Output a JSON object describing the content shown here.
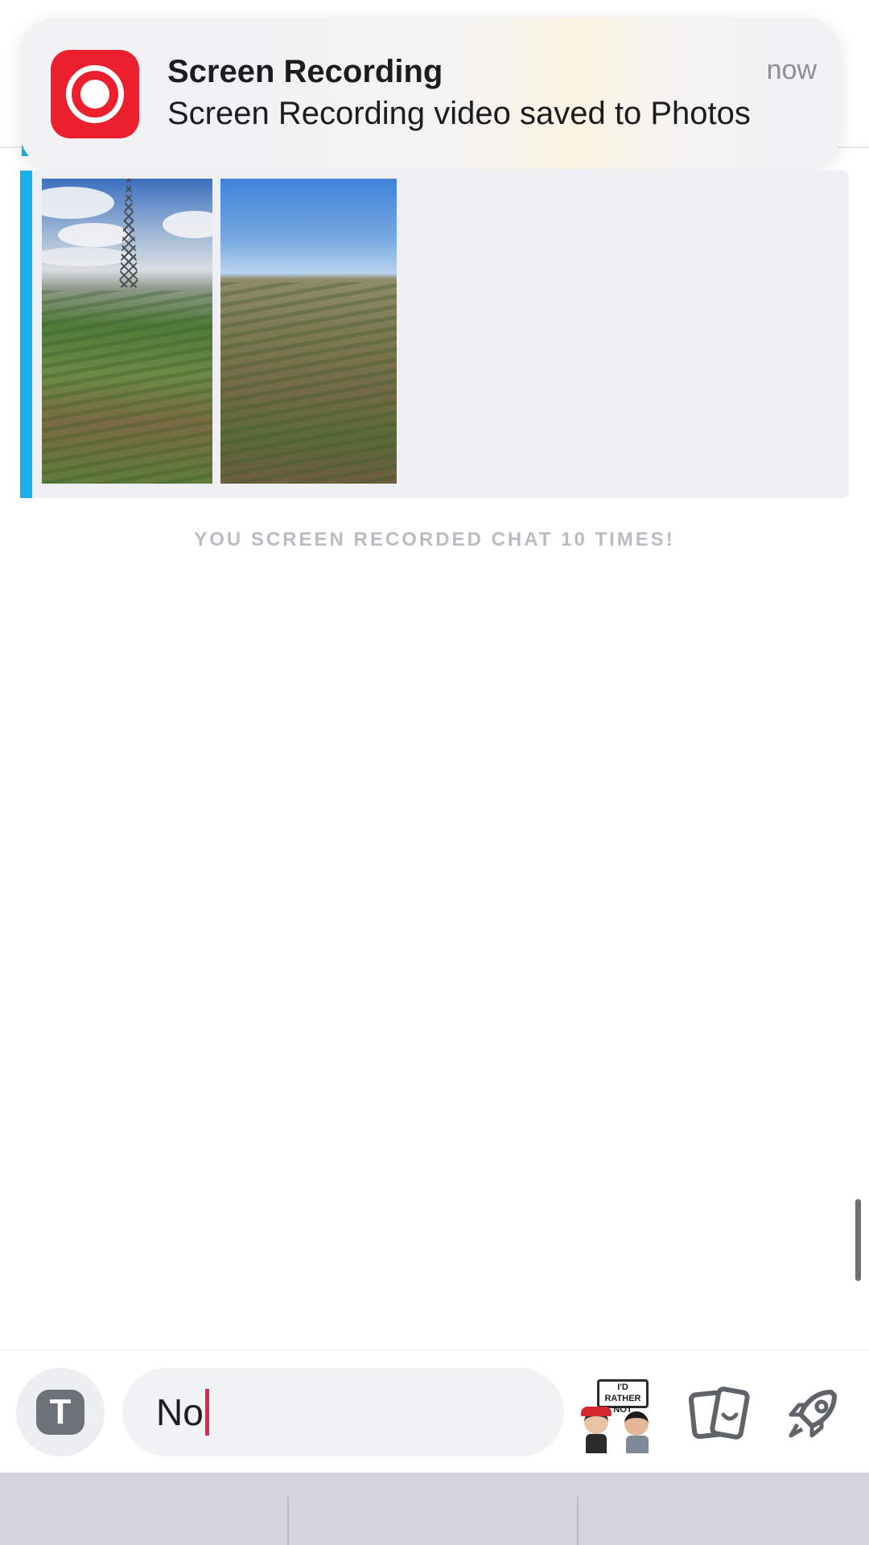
{
  "notification": {
    "app_icon": "screen-recording-icon",
    "title": "Screen Recording",
    "body": "Screen Recording video saved to Photos",
    "time": "now"
  },
  "chat": {
    "media_message": {
      "items": [
        {
          "type": "image",
          "description_icon": "field-power-tower-photo"
        },
        {
          "type": "image",
          "description_icon": "field-blue-sky-photo"
        }
      ]
    },
    "system_note": "YOU SCREEN RECORDED CHAT 10 TIMES!"
  },
  "composer": {
    "text_toggle_icon": "text-icon",
    "text_toggle_label": "T",
    "input_value": "No",
    "bitmoji_sign_text": "I'D RATHER NOT",
    "memories_icon": "memories-icon",
    "games_icon": "rocket-icon"
  },
  "colors": {
    "accent_blue": "#1ab0e6",
    "caret_pink": "#e3224f",
    "recording_red": "#ec1f2e"
  }
}
